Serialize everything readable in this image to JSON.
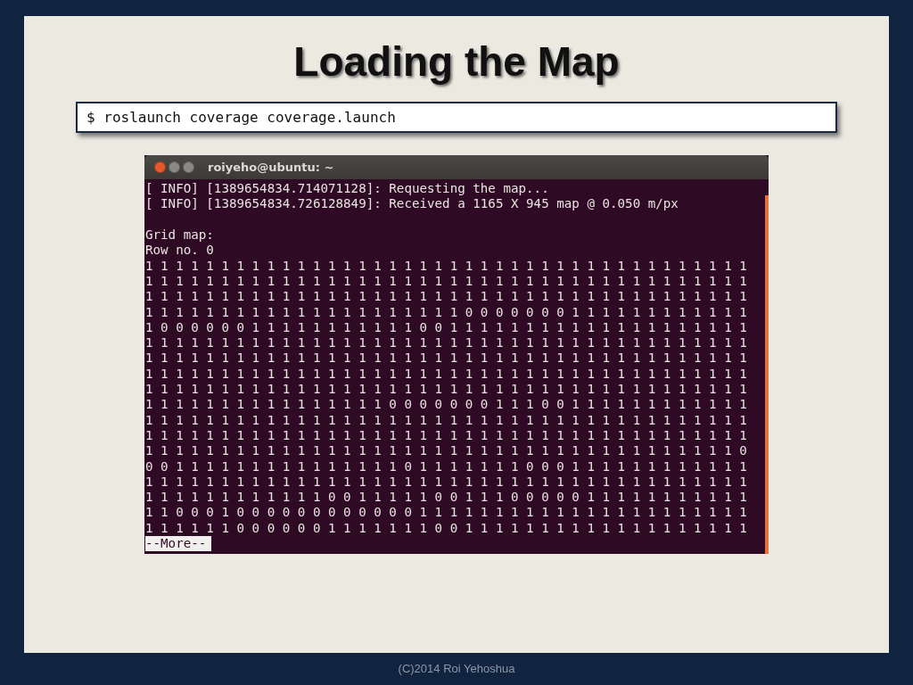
{
  "slide": {
    "title": "Loading the Map",
    "command": "$ roslaunch coverage coverage.launch",
    "terminal": {
      "title": "roiyeho@ubuntu: ~",
      "log": [
        "[ INFO] [1389654834.714071128]: Requesting the map...",
        "[ INFO] [1389654834.726128849]: Received a 1165 X 945 map @ 0.050 m/px"
      ],
      "grid_title": "Grid map:",
      "row_label": "Row no. 0",
      "rows": [
        "1 1 1 1 1 1 1 1 1 1 1 1 1 1 1 1 1 1 1 1 1 1 1 1 1 1 1 1 1 1 1 1 1 1 1 1 1 1 1 1",
        "1 1 1 1 1 1 1 1 1 1 1 1 1 1 1 1 1 1 1 1 1 1 1 1 1 1 1 1 1 1 1 1 1 1 1 1 1 1 1 1",
        "1 1 1 1 1 1 1 1 1 1 1 1 1 1 1 1 1 1 1 1 1 1 1 1 1 1 1 1 1 1 1 1 1 1 1 1 1 1 1 1",
        "1 1 1 1 1 1 1 1 1 1 1 1 1 1 1 1 1 1 1 1 1 0 0 0 0 0 0 0 1 1 1 1 1 1 1 1 1 1 1 1",
        "1 0 0 0 0 0 0 1 1 1 1 1 1 1 1 1 1 1 0 0 1 1 1 1 1 1 1 1 1 1 1 1 1 1 1 1 1 1 1 1",
        "1 1 1 1 1 1 1 1 1 1 1 1 1 1 1 1 1 1 1 1 1 1 1 1 1 1 1 1 1 1 1 1 1 1 1 1 1 1 1 1",
        "1 1 1 1 1 1 1 1 1 1 1 1 1 1 1 1 1 1 1 1 1 1 1 1 1 1 1 1 1 1 1 1 1 1 1 1 1 1 1 1",
        "1 1 1 1 1 1 1 1 1 1 1 1 1 1 1 1 1 1 1 1 1 1 1 1 1 1 1 1 1 1 1 1 1 1 1 1 1 1 1 1",
        "1 1 1 1 1 1 1 1 1 1 1 1 1 1 1 1 1 1 1 1 1 1 1 1 1 1 1 1 1 1 1 1 1 1 1 1 1 1 1 1",
        "1 1 1 1 1 1 1 1 1 1 1 1 1 1 1 1 0 0 0 0 0 0 0 1 1 1 0 0 1 1 1 1 1 1 1 1 1 1 1 1",
        "1 1 1 1 1 1 1 1 1 1 1 1 1 1 1 1 1 1 1 1 1 1 1 1 1 1 1 1 1 1 1 1 1 1 1 1 1 1 1 1",
        "1 1 1 1 1 1 1 1 1 1 1 1 1 1 1 1 1 1 1 1 1 1 1 1 1 1 1 1 1 1 1 1 1 1 1 1 1 1 1 1",
        "1 1 1 1 1 1 1 1 1 1 1 1 1 1 1 1 1 1 1 1 1 1 1 1 1 1 1 1 1 1 1 1 1 1 1 1 1 1 1 0",
        "0 0 1 1 1 1 1 1 1 1 1 1 1 1 1 1 1 0 1 1 1 1 1 1 1 0 0 0 1 1 1 1 1 1 1 1 1 1 1 1",
        "1 1 1 1 1 1 1 1 1 1 1 1 1 1 1 1 1 1 1 1 1 1 1 1 1 1 1 1 1 1 1 1 1 1 1 1 1 1 1 1",
        "1 1 1 1 1 1 1 1 1 1 1 1 0 0 1 1 1 1 1 0 0 1 1 1 0 0 0 0 0 1 1 1 1 1 1 1 1 1 1 1",
        "1 1 0 0 0 1 0 0 0 0 0 0 0 0 0 0 0 0 1 1 1 1 1 1 1 1 1 1 1 1 1 1 1 1 1 1 1 1 1 1",
        "1 1 1 1 1 1 0 0 0 0 0 0 1 1 1 1 1 1 1 0 0 1 1 1 1 1 1 1 1 1 1 1 1 1 1 1 1 1 1 1"
      ],
      "pager": "--More--"
    }
  },
  "footer": "(C)2014 Roi Yehoshua"
}
